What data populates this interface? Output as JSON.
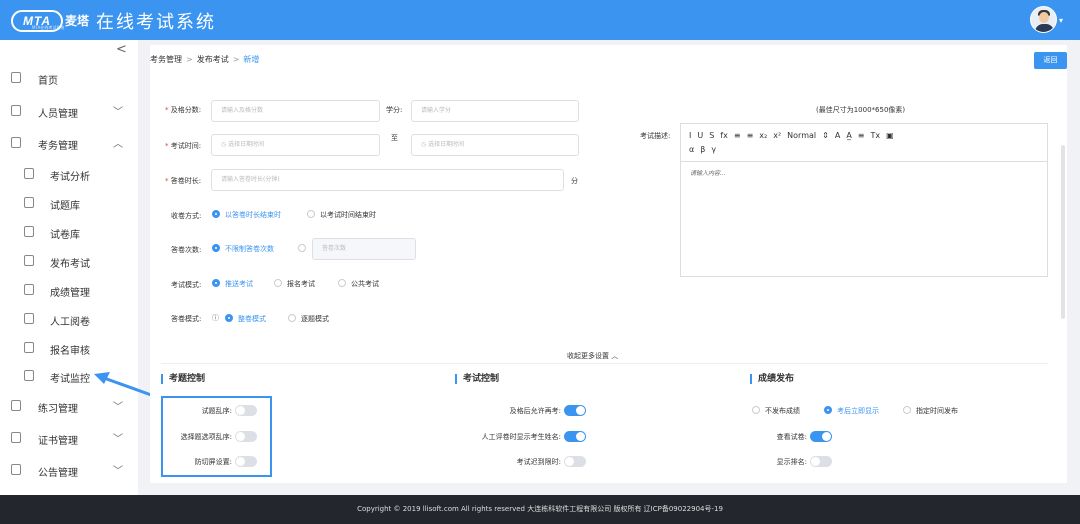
{
  "header": {
    "logo_mark": "MTA",
    "logo_cn": "麦塔",
    "logo_sub": "MTA在线考试系统",
    "app_title": "在线考试系统"
  },
  "sidebar": {
    "collapse_glyph": "<",
    "items": [
      {
        "label": "首页",
        "icon": "home-icon"
      },
      {
        "label": "人员管理",
        "icon": "user-icon",
        "chevron": "﹀"
      },
      {
        "label": "考务管理",
        "icon": "exam-icon",
        "chevron": "︿"
      },
      {
        "label": "考试分析",
        "icon": "doc-icon"
      },
      {
        "label": "试题库",
        "icon": "doc-icon"
      },
      {
        "label": "试卷库",
        "icon": "doc-icon"
      },
      {
        "label": "发布考试",
        "icon": "doc-icon"
      },
      {
        "label": "成绩管理",
        "icon": "check-icon"
      },
      {
        "label": "人工阅卷",
        "icon": "doc-icon"
      },
      {
        "label": "报名审核",
        "icon": "doc-icon"
      },
      {
        "label": "考试监控",
        "icon": "doc-icon"
      },
      {
        "label": "练习管理",
        "icon": "edit-icon",
        "chevron": "﹀"
      },
      {
        "label": "证书管理",
        "icon": "cert-icon",
        "chevron": "﹀"
      },
      {
        "label": "公告管理",
        "icon": "bell-icon",
        "chevron": "﹀"
      }
    ]
  },
  "breadcrumb": {
    "l1": "考务管理",
    "l2": "发布考试",
    "l3": "新增",
    "sep": ">"
  },
  "back_label": "返回",
  "form": {
    "pass_label": "及格分数:",
    "pass_ph": "请输入及格分数",
    "credit_label": "学分:",
    "credit_ph": "请输入学分",
    "time_label": "考试时间:",
    "time_start_ph": "选择日期时间",
    "to_label": "至",
    "time_end_ph": "选择日期时间",
    "duration_label": "答卷时长:",
    "duration_ph": "请输入答卷时长(分钟)",
    "minute_unit": "分",
    "submit_label": "收卷方式:",
    "submit_opt1": "以答卷时长结束时",
    "submit_opt2": "以考试时间结束时",
    "attempts_label": "答卷次数:",
    "attempts_opt1": "不限制答卷次数",
    "attempts_ph": "答卷次数",
    "mode_label": "考试模式:",
    "mode_opt1": "推送考试",
    "mode_opt2": "报名考试",
    "mode_opt3": "公共考试",
    "answer_label": "答卷模式:",
    "answer_opt1": "整卷模式",
    "answer_opt2": "逐题模式",
    "size_hint": "(最佳尺寸为1000*650像素)",
    "desc_label": "考试描述:",
    "editor_tools_row1": [
      "I",
      "U",
      "S",
      "fx",
      "≡",
      "≡",
      "x₂",
      "x²",
      "Normal",
      "⇕",
      "A",
      "A̲",
      "≡",
      "Tx",
      "▣"
    ],
    "editor_tools_row2": [
      "α",
      "β",
      "γ"
    ],
    "editor_ph": "请输入内容..."
  },
  "more_toggle": "收起更多设置 ︿",
  "sections": {
    "question": {
      "title": "考题控制",
      "rows": [
        {
          "label": "试题乱序:",
          "on": false
        },
        {
          "label": "选择题选项乱序:",
          "on": false
        },
        {
          "label": "防切屏设置:",
          "on": false
        }
      ]
    },
    "exam": {
      "title": "考试控制",
      "rows": [
        {
          "label": "及格后允许再考:",
          "on": true
        },
        {
          "label": "人工评卷时显示考生姓名:",
          "on": true
        },
        {
          "label": "考试迟到限时:",
          "on": false
        }
      ]
    },
    "grade": {
      "title": "成绩发布",
      "opt1": "不发布成绩",
      "opt2": "考后立即显示",
      "opt3": "指定时间发布",
      "rows": [
        {
          "label": "查看试卷:",
          "on": true
        },
        {
          "label": "显示排名:",
          "on": false
        }
      ]
    }
  },
  "footer": "Copyright © 2019 llisoft.com All rights reserved 大连栋科软件工程有限公司 版权所有 辽ICP备09022904号-19"
}
